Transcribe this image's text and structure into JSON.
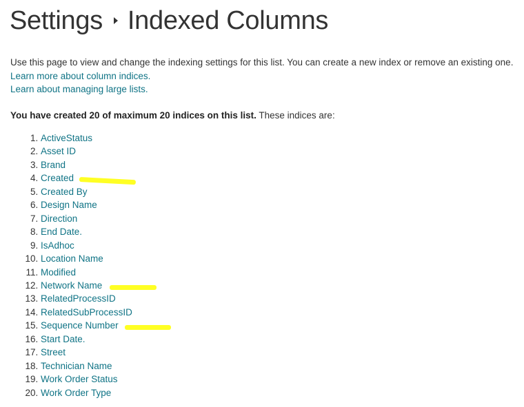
{
  "header": {
    "breadcrumb_parent": "Settings",
    "breadcrumb_current": "Indexed Columns",
    "separator_icon": "triangle-right-icon"
  },
  "intro": {
    "description": "Use this page to view and change the indexing settings for this list. You can create a new index or remove an existing one.",
    "link_column_indices": "Learn more about column indices.",
    "link_large_lists": "Learn about managing large lists."
  },
  "summary": {
    "bold_text": "You have created 20 of maximum 20 indices on this list.",
    "trailing_text": " These indices are:"
  },
  "indices": [
    {
      "label": "ActiveStatus",
      "highlighted": false
    },
    {
      "label": "Asset ID",
      "highlighted": false
    },
    {
      "label": "Brand",
      "highlighted": false
    },
    {
      "label": "Created",
      "highlighted": true
    },
    {
      "label": "Created By",
      "highlighted": false
    },
    {
      "label": "Design Name",
      "highlighted": false
    },
    {
      "label": "Direction",
      "highlighted": false
    },
    {
      "label": "End Date.",
      "highlighted": false
    },
    {
      "label": "IsAdhoc",
      "highlighted": false
    },
    {
      "label": "Location Name",
      "highlighted": false
    },
    {
      "label": "Modified",
      "highlighted": false
    },
    {
      "label": "Network Name",
      "highlighted": true
    },
    {
      "label": "RelatedProcessID",
      "highlighted": false
    },
    {
      "label": "RelatedSubProcessID",
      "highlighted": false
    },
    {
      "label": "Sequence Number",
      "highlighted": true
    },
    {
      "label": "Start Date.",
      "highlighted": false
    },
    {
      "label": "Street",
      "highlighted": false
    },
    {
      "label": "Technician Name",
      "highlighted": false
    },
    {
      "label": "Work Order Status",
      "highlighted": false
    },
    {
      "label": "Work Order Type",
      "highlighted": false
    }
  ],
  "colors": {
    "link": "#0f7385",
    "text": "#333333",
    "highlight": "#ffff24"
  }
}
